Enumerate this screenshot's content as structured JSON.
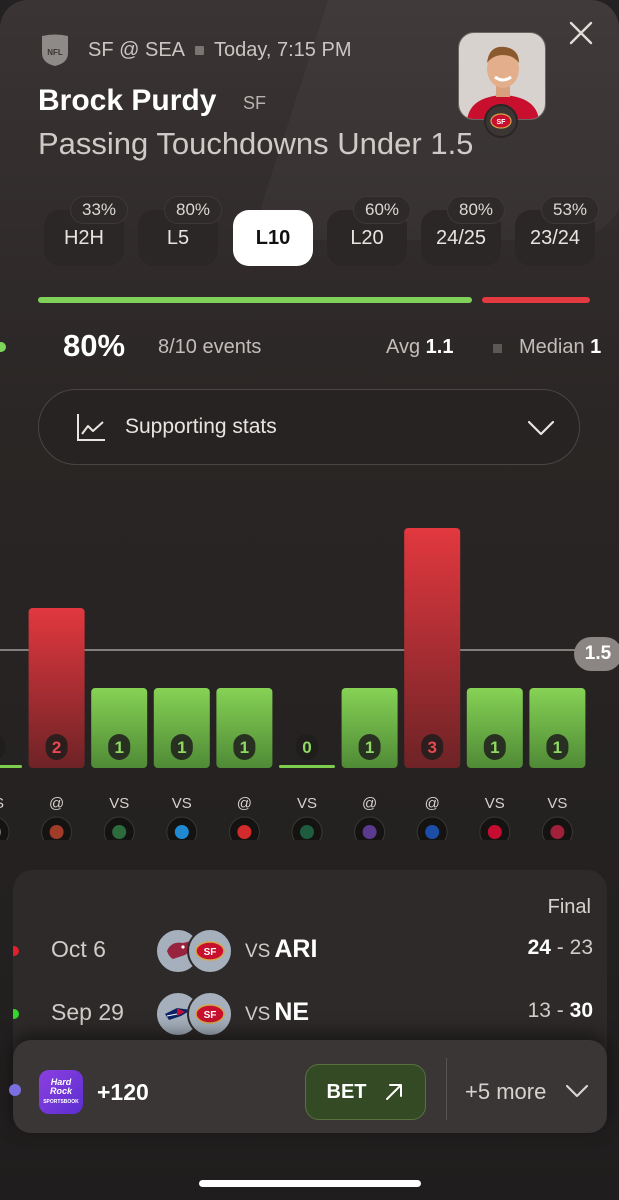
{
  "header": {
    "league": "NFL",
    "matchup": "SF @ SEA",
    "game_time": "Today, 7:15 PM",
    "player_name": "Brock Purdy",
    "player_team": "SF",
    "prop_title": "Passing Touchdowns Under 1.5"
  },
  "tabs": [
    {
      "label": "H2H",
      "pct": "33%",
      "active": false
    },
    {
      "label": "L5",
      "pct": "80%",
      "active": false
    },
    {
      "label": "L10",
      "pct": "",
      "active": true
    },
    {
      "label": "L20",
      "pct": "60%",
      "active": false
    },
    {
      "label": "24/25",
      "pct": "80%",
      "active": false
    },
    {
      "label": "23/24",
      "pct": "53%",
      "active": false
    }
  ],
  "summary": {
    "hit_rate": "80%",
    "hit_rate_fraction": 0.8,
    "events": "8/10 events",
    "avg_label": "Avg",
    "avg_value": "1.1",
    "median_label": "Median",
    "median_value": "1"
  },
  "supporting_stats": {
    "label": "Supporting stats"
  },
  "chart_data": {
    "type": "bar",
    "line": 1.5,
    "line_label": "1.5",
    "ylim": [
      0,
      3.5
    ],
    "values": [
      0,
      2,
      1,
      1,
      1,
      0,
      1,
      3,
      1,
      1
    ],
    "location": [
      "VS",
      "@",
      "VS",
      "VS",
      "@",
      "VS",
      "@",
      "@",
      "VS",
      "VS"
    ],
    "opponents": [
      "opponent",
      "WAS",
      "GB",
      "DET",
      "KC",
      "NYJ",
      "MIN",
      "LAR",
      "NE",
      "ARI"
    ],
    "colors": {
      "under": "#7fcd4f",
      "over": "#e0323b"
    }
  },
  "games": {
    "status": "Final",
    "rows": [
      {
        "date": "Oct 6",
        "vs": "VS",
        "opponent": "ARI",
        "team_score": "24",
        "opp_score": "23",
        "dot_color": "#e0202a",
        "opp_logo": "ARI",
        "opp_color": "#97233f",
        "bold": "left"
      },
      {
        "date": "Sep 29",
        "vs": "VS",
        "opponent": "NE",
        "team_score": "13",
        "opp_score": "30",
        "dot_color": "#35d62a",
        "opp_logo": "NE",
        "opp_color": "#0b2265",
        "bold": "right"
      }
    ]
  },
  "bottom": {
    "book_name": "Hard Rock",
    "book_sub": "SPORTSBOOK",
    "odds": "+120",
    "bet_label": "BET",
    "more_label": "+5 more"
  }
}
